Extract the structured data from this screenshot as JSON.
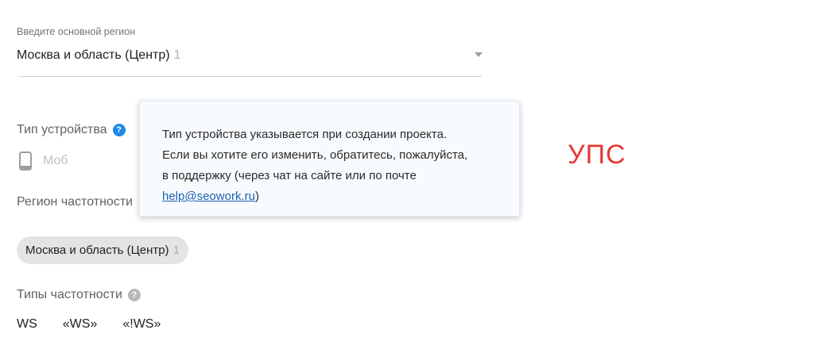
{
  "region_select": {
    "label": "Введите основной регион",
    "value": "Москва и область (Центр)",
    "count": "1"
  },
  "device_type": {
    "label": "Тип устройства",
    "help_icon": "?",
    "option_label": "Моб",
    "icon": "smartphone-icon"
  },
  "tooltip": {
    "line1": "Тип устройства указывается при создании проекта.",
    "line2": "Если вы хотите его изменить, обратитесь, пожалуйста,",
    "line3": "в поддержку (через чат на сайте или по почте",
    "email": "help@seowork.ru",
    "after_email": ")"
  },
  "frequency_region": {
    "label": "Регион частотности",
    "chip_text": "Москва и область (Центр)",
    "chip_count": "1"
  },
  "frequency_types": {
    "label": "Типы частотности",
    "help_icon": "?",
    "options": [
      "WS",
      "«WS»",
      "«!WS»"
    ]
  },
  "annotation": {
    "text": "УПС",
    "color": "#e53935"
  },
  "colors": {
    "accent": "#1e88e5",
    "link": "#1a5fb4"
  }
}
